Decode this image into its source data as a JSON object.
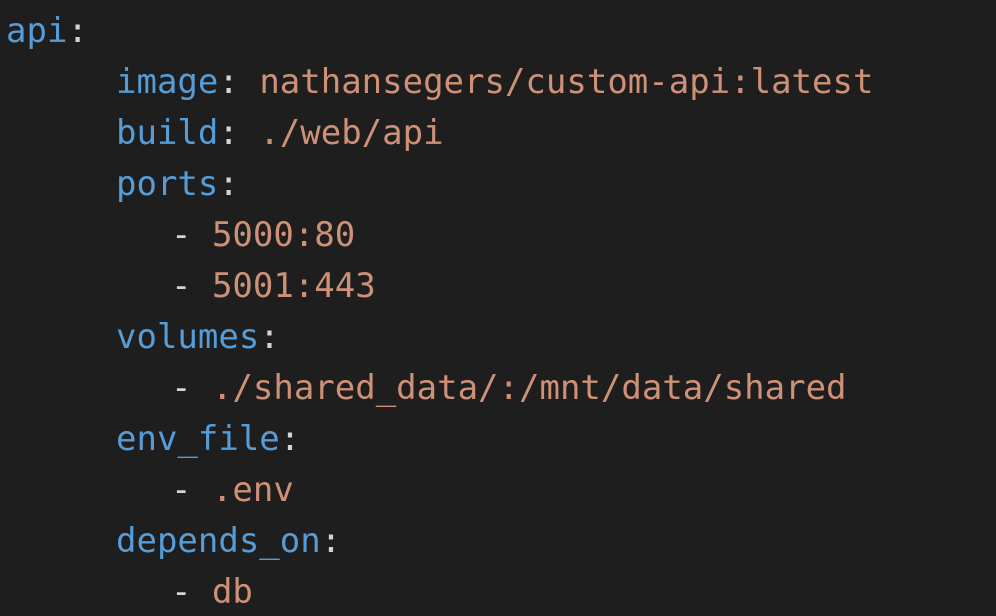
{
  "colors": {
    "background": "#1e1e1e",
    "key": "#569cd6",
    "value": "#ce9178",
    "punctuation": "#d4d4d4"
  },
  "code": {
    "service_key": "api",
    "colon": ":",
    "dash": "- ",
    "image_key": "image",
    "image_value": "nathansegers/custom-api:latest",
    "build_key": "build",
    "build_value": "./web/api",
    "ports_key": "ports",
    "ports": [
      "5000:80",
      "5001:443"
    ],
    "volumes_key": "volumes",
    "volumes": [
      "./shared_data/:/mnt/data/shared"
    ],
    "env_file_key": "env_file",
    "env_file": [
      ".env"
    ],
    "depends_on_key": "depends_on",
    "depends_on": [
      "db"
    ]
  }
}
